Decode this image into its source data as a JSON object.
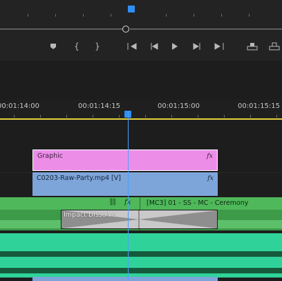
{
  "timeline": {
    "ruler_timecodes": [
      "00:01:14:00",
      "00:01:14:15",
      "00:01:15:00",
      "00:01:15:15"
    ],
    "clips": {
      "graphic": {
        "name": "Graphic",
        "fx": "fx"
      },
      "video": {
        "name": "C0203-Raw-Party.mp4 [V]",
        "fx": "fx"
      },
      "multicam": {
        "name": "[MC3] 01 - SS - MC - Ceremony",
        "fx": "fx"
      },
      "transition": {
        "name": "Impact Dissolve"
      }
    }
  },
  "colors": {
    "graphic": "#ec8ee8",
    "video": "#7ea5d9",
    "multicam": "#4fb85a",
    "audio": "#2fd39a",
    "playhead": "#2f8ff5",
    "work_area": "#e4d13a"
  },
  "toolbar_icons": [
    "marker-icon",
    "mark-in-icon",
    "mark-out-icon",
    "go-to-in-icon",
    "step-back-icon",
    "play-icon",
    "step-forward-icon",
    "go-to-out-icon",
    "lift-icon",
    "extract-icon"
  ]
}
